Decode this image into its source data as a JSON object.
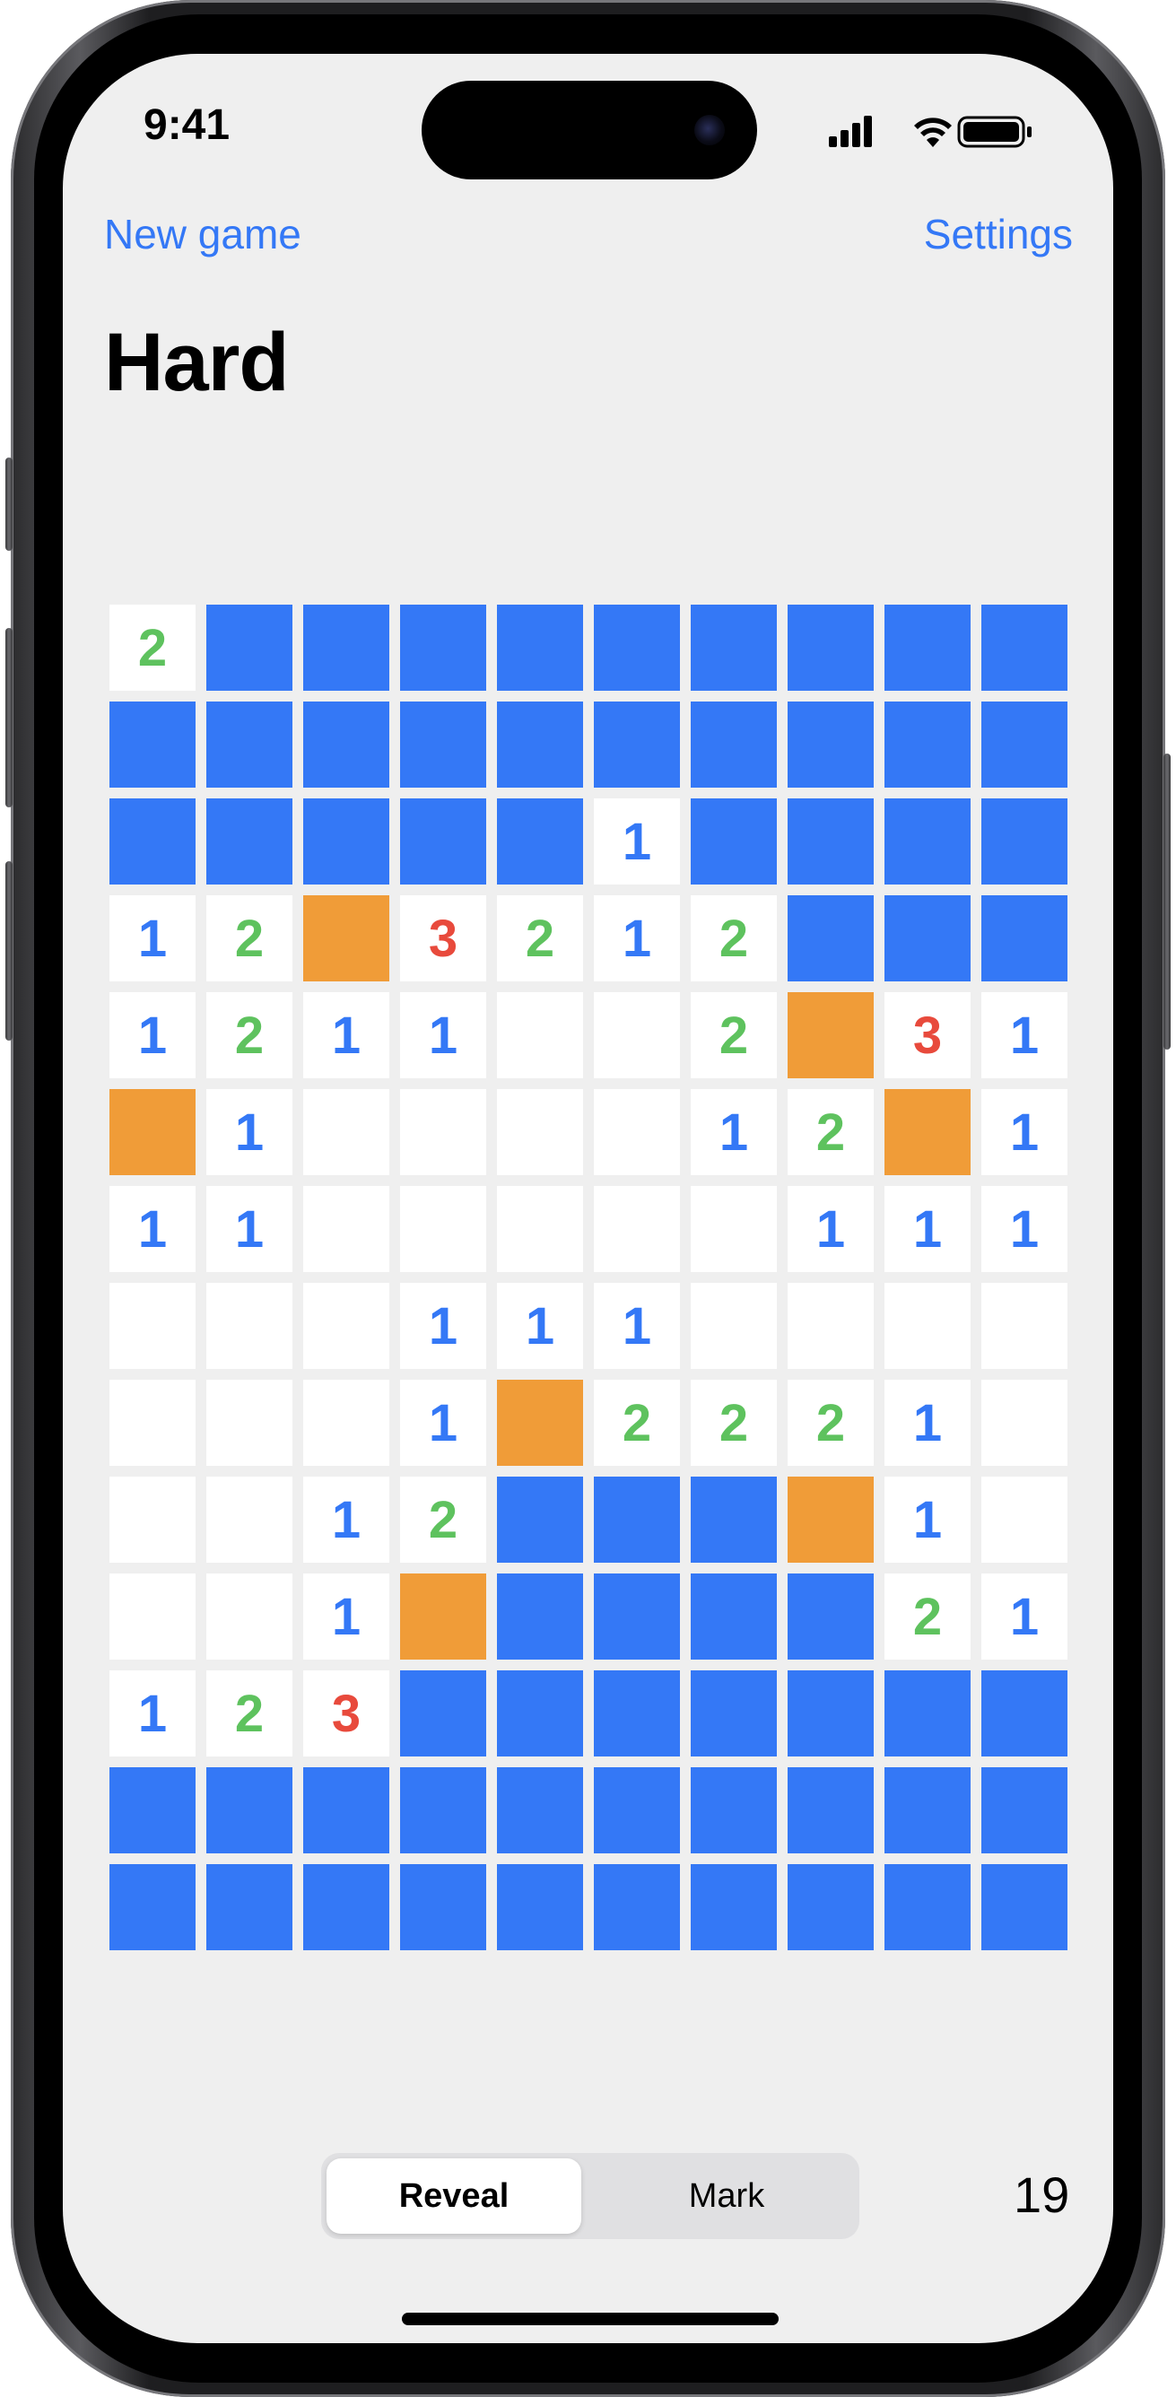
{
  "status_bar": {
    "time": "9:41",
    "icons": [
      "cellular-signal-icon",
      "wifi-icon",
      "battery-icon"
    ]
  },
  "nav": {
    "left_label": "New game",
    "right_label": "Settings"
  },
  "title": "Hard",
  "board": {
    "columns": 10,
    "rows": 14,
    "legend": {
      "H": "hidden",
      "F": "flagged",
      "E": "revealed-empty",
      "1": "revealed-number",
      "2": "revealed-number",
      "3": "revealed-number"
    },
    "cells": [
      [
        "2",
        "H",
        "H",
        "H",
        "H",
        "H",
        "H",
        "H",
        "H",
        "H"
      ],
      [
        "H",
        "H",
        "H",
        "H",
        "H",
        "H",
        "H",
        "H",
        "H",
        "H"
      ],
      [
        "H",
        "H",
        "H",
        "H",
        "H",
        "1",
        "H",
        "H",
        "H",
        "H"
      ],
      [
        "1",
        "2",
        "F",
        "3",
        "2",
        "1",
        "2",
        "H",
        "H",
        "H"
      ],
      [
        "1",
        "2",
        "1",
        "1",
        "E",
        "E",
        "2",
        "F",
        "3",
        "1"
      ],
      [
        "F",
        "1",
        "E",
        "E",
        "E",
        "E",
        "1",
        "2",
        "F",
        "1"
      ],
      [
        "1",
        "1",
        "E",
        "E",
        "E",
        "E",
        "E",
        "1",
        "1",
        "1"
      ],
      [
        "E",
        "E",
        "E",
        "1",
        "1",
        "1",
        "E",
        "E",
        "E",
        "E"
      ],
      [
        "E",
        "E",
        "E",
        "1",
        "F",
        "2",
        "2",
        "2",
        "1",
        "E"
      ],
      [
        "E",
        "E",
        "1",
        "2",
        "H",
        "H",
        "H",
        "F",
        "1",
        "E"
      ],
      [
        "E",
        "E",
        "1",
        "F",
        "H",
        "H",
        "H",
        "H",
        "2",
        "1"
      ],
      [
        "1",
        "2",
        "3",
        "H",
        "H",
        "H",
        "H",
        "H",
        "H",
        "H"
      ],
      [
        "H",
        "H",
        "H",
        "H",
        "H",
        "H",
        "H",
        "H",
        "H",
        "H"
      ],
      [
        "H",
        "H",
        "H",
        "H",
        "H",
        "H",
        "H",
        "H",
        "H",
        "H"
      ]
    ]
  },
  "mode_control": {
    "options": [
      "Reveal",
      "Mark"
    ],
    "selected": "Reveal"
  },
  "counter": "19",
  "colors": {
    "hidden": "#3478f6",
    "flag": "#f09c38",
    "revealed": "#ffffff",
    "number_1": "#3478f6",
    "number_2": "#5ec25e",
    "number_3": "#e84a3c",
    "accent": "#3478f6",
    "background": "#efefef"
  }
}
